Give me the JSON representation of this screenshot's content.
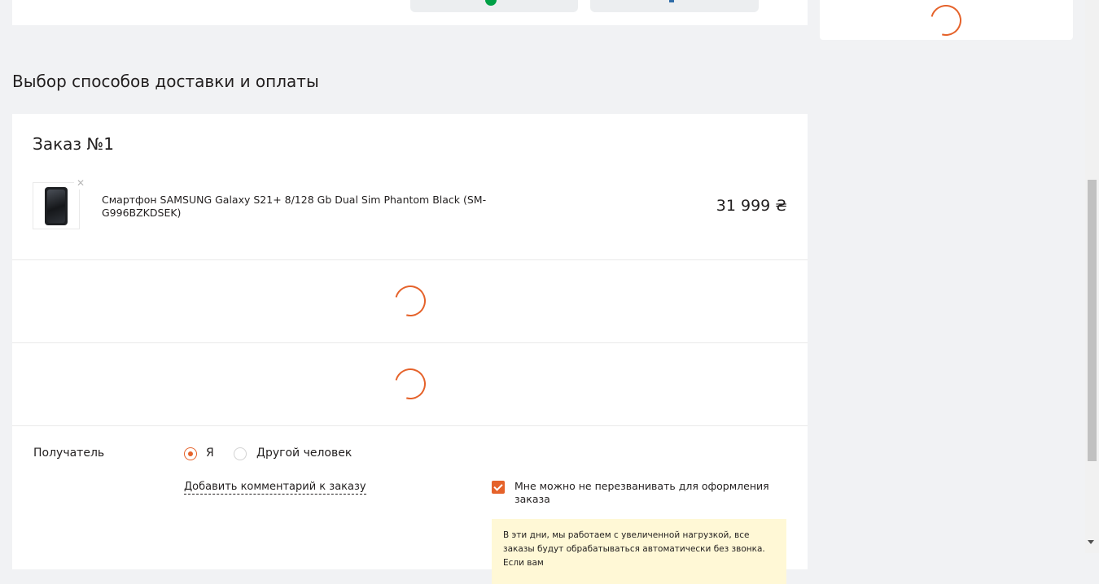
{
  "page": {
    "section_title": "Выбор способов доставки и оплаты"
  },
  "order": {
    "title": "Заказ №1",
    "product": {
      "name": "Смартфон SAMSUNG Galaxy S21+ 8/128 Gb Dual Sim Phantom Black (SM-G996BZKDSEK)",
      "price": "31 999 ₴",
      "remove_icon": "close-icon"
    },
    "recipient": {
      "label": "Получатель",
      "options": [
        {
          "label": "Я",
          "selected": true
        },
        {
          "label": "Другой человек",
          "selected": false
        }
      ]
    },
    "comment_link": "Добавить комментарий к заказу",
    "no_call": {
      "checked": true,
      "label": "Мне можно не перезванивать для оформления заказа"
    },
    "notice": "В эти дни, мы работаем с увеличенной нагрузкой, все заказы будут обрабатываться автоматически без звонка. Если вам"
  },
  "colors": {
    "accent": "#e5622a",
    "success": "#00a046",
    "background": "#f1f2f4",
    "notice_bg": "#fff8d6"
  }
}
